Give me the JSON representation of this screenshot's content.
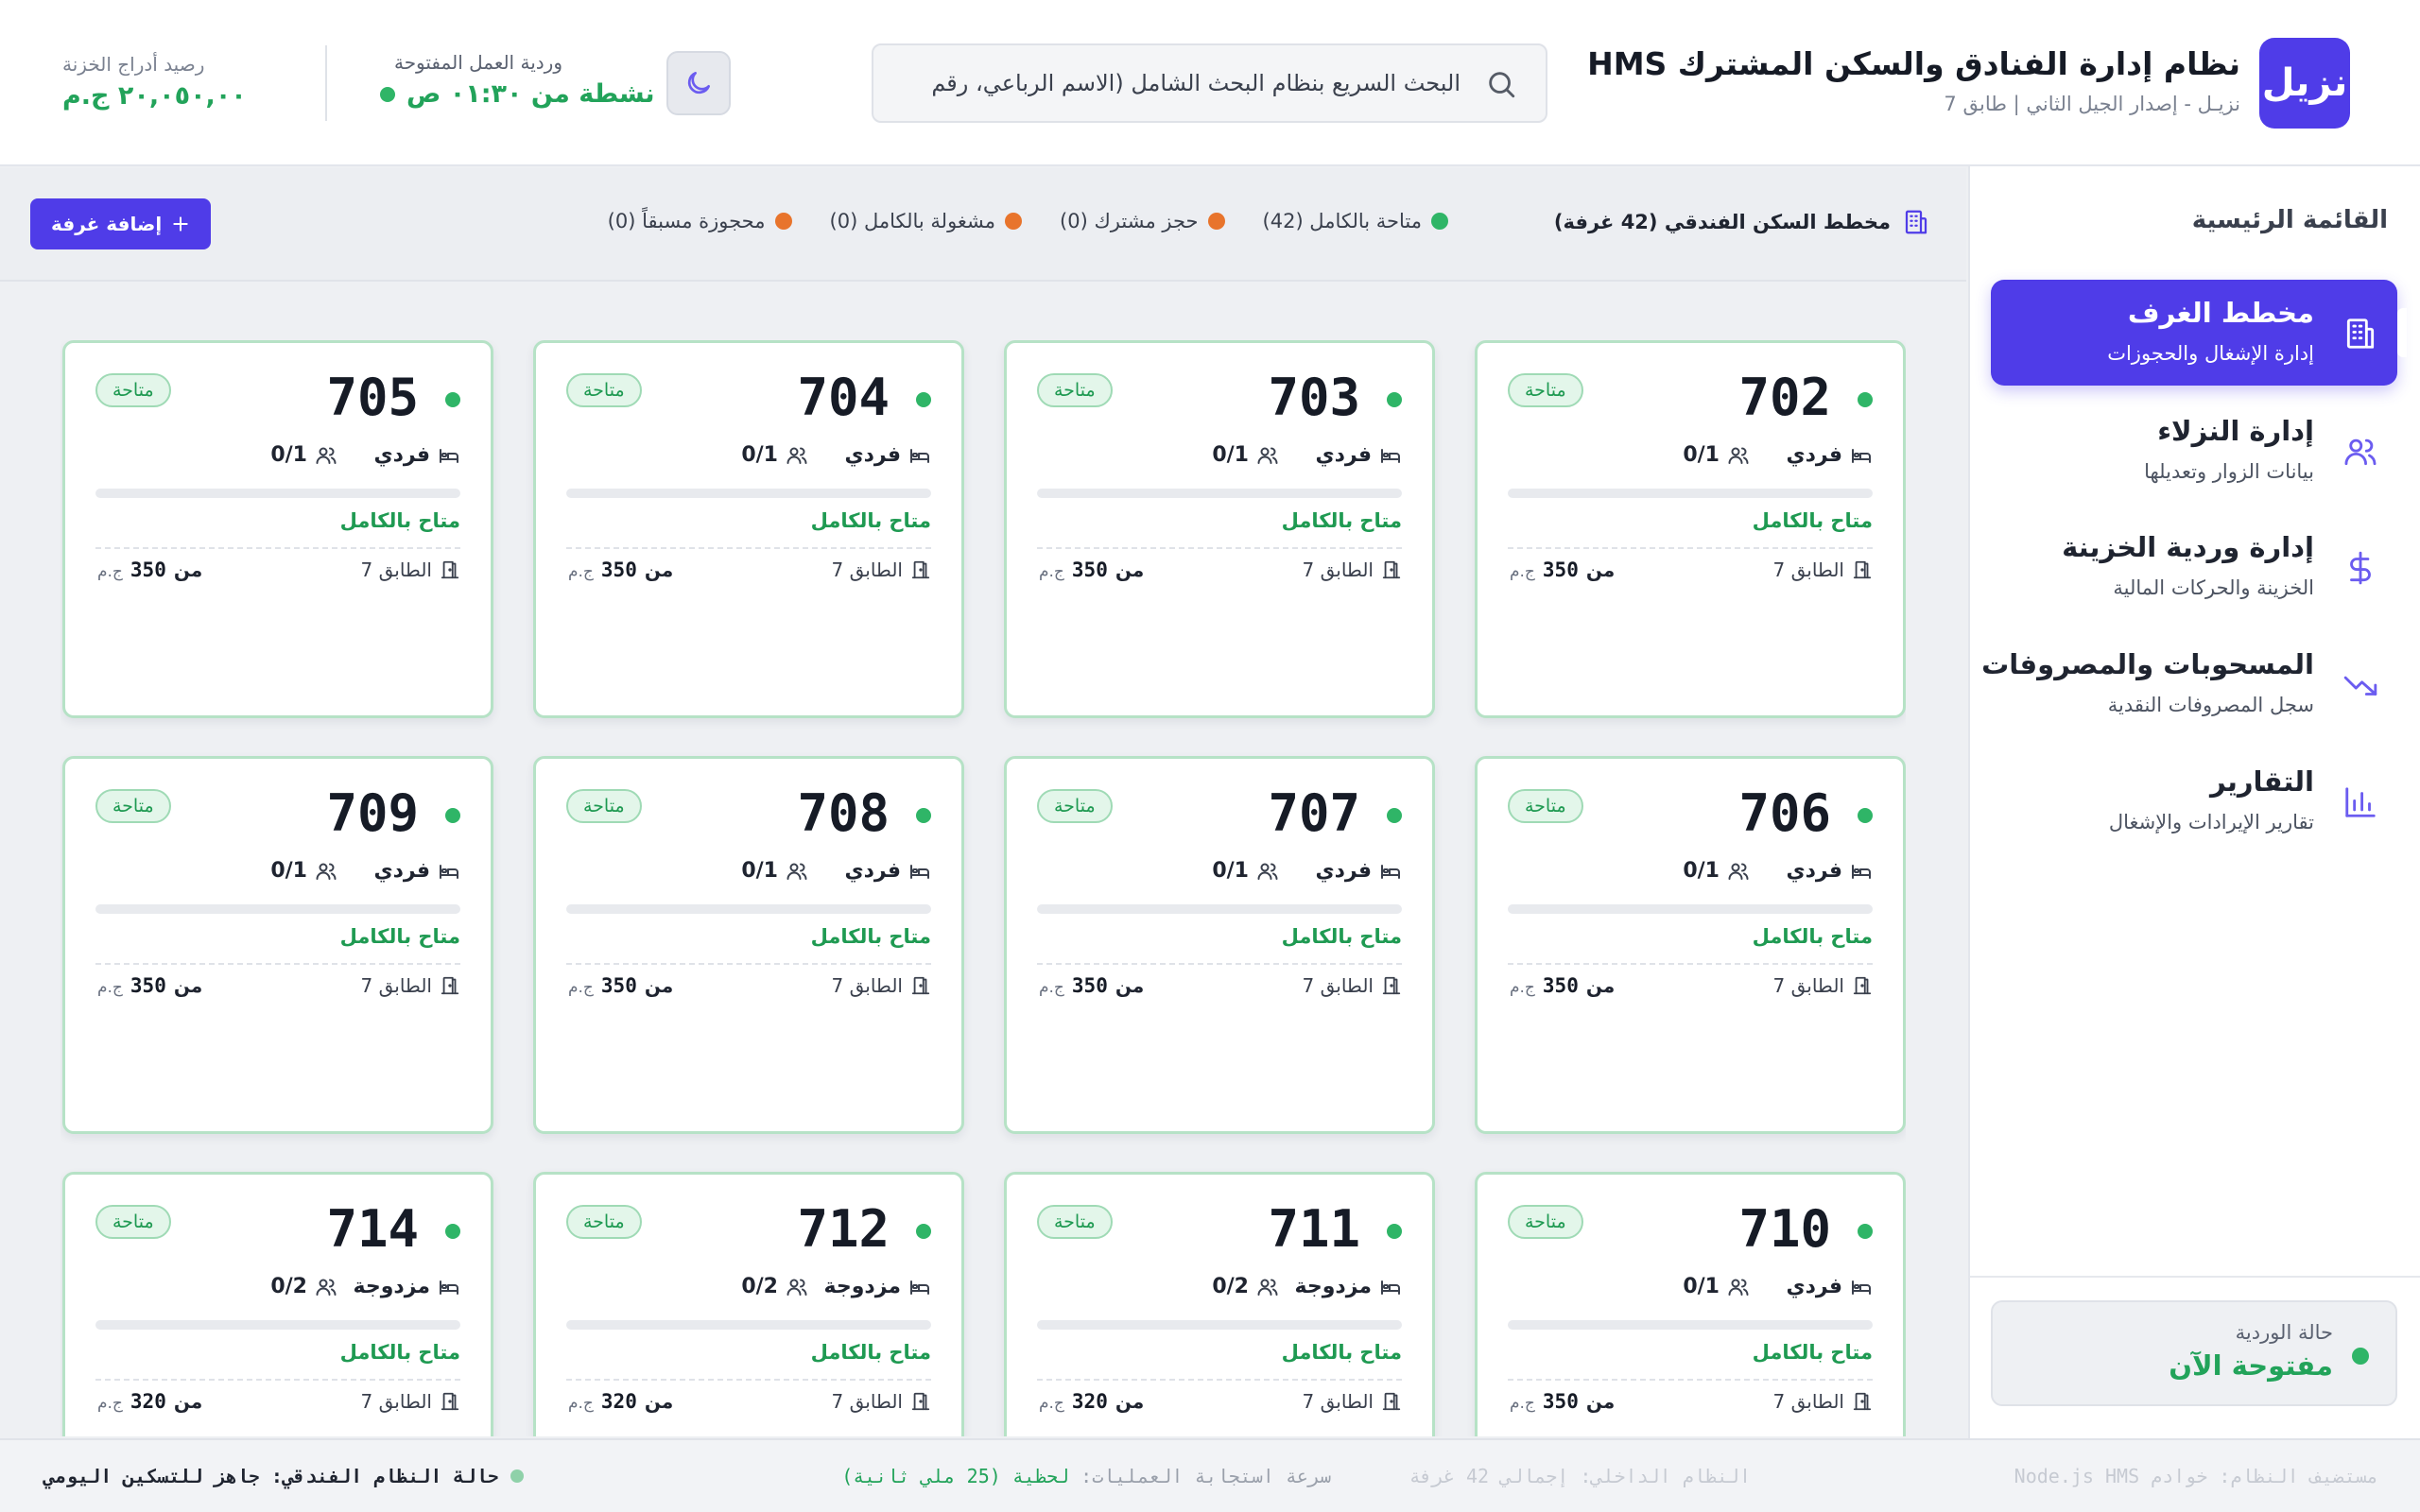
{
  "header": {
    "logo_text": "نزيل",
    "title": "نظام إدارة الفنادق والسكن المشترك HMS",
    "subtitle": "نزيـل - إصدار الجيل الثاني | طابق 7",
    "search_placeholder": "البحث السريع بنظام البحث الشامل (الاسم الرباعي، رقم",
    "shift_label": "وردية العمل المفتوحة",
    "shift_status": "نشطة من ٠١:٣٠ ص",
    "balance_label": "رصيد أدراج الخزنة",
    "balance_value": "٢٠,٠٥٠,٠٠ ج.م"
  },
  "sidebar": {
    "title": "القائمة الرئيسية",
    "items": [
      {
        "title": "مخطط الغرف",
        "subtitle": "إدارة الإشغال والحجوزات",
        "icon": "building-icon",
        "active": true
      },
      {
        "title": "إدارة النزلاء",
        "subtitle": "بيانات الزوار وتعديلها",
        "icon": "users-icon",
        "active": false
      },
      {
        "title": "إدارة وردية الخزينة",
        "subtitle": "الخزينة والحركات المالية",
        "icon": "dollar-icon",
        "active": false
      },
      {
        "title": "المسحوبات والمصروفات",
        "subtitle": "سجل المصروفات النقدية",
        "icon": "trending-down-icon",
        "active": false
      },
      {
        "title": "التقارير",
        "subtitle": "تقارير الإيرادات والإشغال",
        "icon": "bar-chart-icon",
        "active": false
      }
    ],
    "shift_card": {
      "label": "حالة الوردية",
      "value": "مفتوحة الآن"
    }
  },
  "legendbar": {
    "title": "مخطط السكن الفندقي (42 غرفة)",
    "legend": [
      {
        "label": "متاحة بالكامل (42)",
        "color": "#2fb567"
      },
      {
        "label": "حجز مشترك (0)",
        "color": "#e8742c"
      },
      {
        "label": "مشغولة بالكامل (0)",
        "color": "#e8742c"
      },
      {
        "label": "محجوزة مسبقاً (0)",
        "color": "#e8742c"
      }
    ],
    "add_button": "إضافة غرفة"
  },
  "room_labels": {
    "badge": "متاحة",
    "availability": "متاح بالكامل",
    "price_prefix": "من",
    "currency": "ج.م"
  },
  "rooms": [
    {
      "number": "702",
      "type": "فردي",
      "occupancy": "0/1",
      "floor": "الطابق 7",
      "price": "350"
    },
    {
      "number": "703",
      "type": "فردي",
      "occupancy": "0/1",
      "floor": "الطابق 7",
      "price": "350"
    },
    {
      "number": "704",
      "type": "فردي",
      "occupancy": "0/1",
      "floor": "الطابق 7",
      "price": "350"
    },
    {
      "number": "705",
      "type": "فردي",
      "occupancy": "0/1",
      "floor": "الطابق 7",
      "price": "350"
    },
    {
      "number": "706",
      "type": "فردي",
      "occupancy": "0/1",
      "floor": "الطابق 7",
      "price": "350"
    },
    {
      "number": "707",
      "type": "فردي",
      "occupancy": "0/1",
      "floor": "الطابق 7",
      "price": "350"
    },
    {
      "number": "708",
      "type": "فردي",
      "occupancy": "0/1",
      "floor": "الطابق 7",
      "price": "350"
    },
    {
      "number": "709",
      "type": "فردي",
      "occupancy": "0/1",
      "floor": "الطابق 7",
      "price": "350"
    },
    {
      "number": "710",
      "type": "فردي",
      "occupancy": "0/1",
      "floor": "الطابق 7",
      "price": "350"
    },
    {
      "number": "711",
      "type": "مزدوجة",
      "occupancy": "0/2",
      "floor": "الطابق 7",
      "price": "320"
    },
    {
      "number": "712",
      "type": "مزدوجة",
      "occupancy": "0/2",
      "floor": "الطابق 7",
      "price": "320"
    },
    {
      "number": "714",
      "type": "مزدوجة",
      "occupancy": "0/2",
      "floor": "الطابق 7",
      "price": "320"
    }
  ],
  "statusbar": {
    "server": "مستضيف النظام: خوادم Node.js HMS",
    "internal": "النظام الداخلي: إجمالي 42 غرفة",
    "speed_label": "سرعة استجابة العمليات:",
    "speed_value": "لحظية (25 ملي ثانية)",
    "system_status": "حالة النظام الفندقي: جاهز للتسكين اليومي"
  },
  "colors": {
    "accent": "#4f3ce8",
    "success": "#22a35a",
    "warning": "#e8742c"
  }
}
